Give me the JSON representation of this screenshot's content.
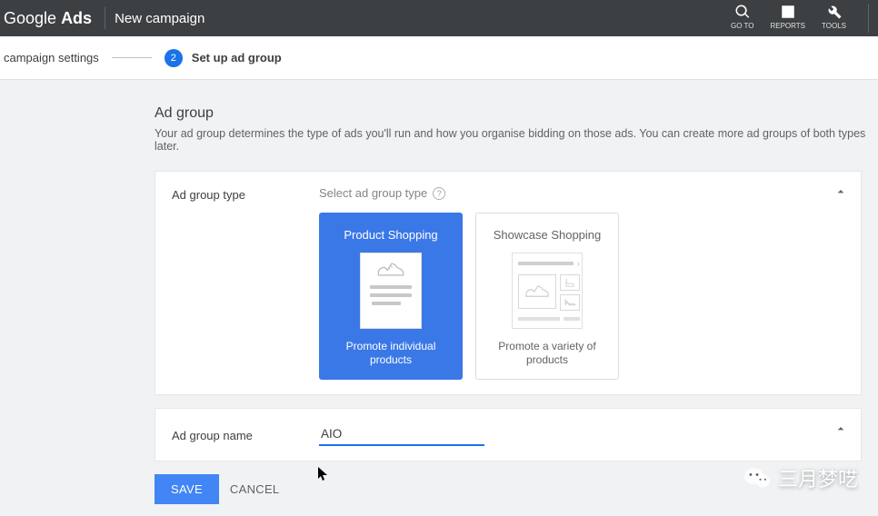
{
  "header": {
    "logo_a": "Google",
    "logo_b": "Ads",
    "title": "New campaign",
    "tools": [
      {
        "label": "GO TO",
        "icon": "search"
      },
      {
        "label": "REPORTS",
        "icon": "bar"
      },
      {
        "label": "TOOLS",
        "icon": "wrench"
      }
    ]
  },
  "steps": {
    "prev": "campaign settings",
    "active_num": "2",
    "active_label": "Set up ad group"
  },
  "section": {
    "title": "Ad group",
    "subtitle": "Your ad group determines the type of ads you'll run and how you organise bidding on those ads. You can create more ad groups of both types later."
  },
  "ad_group_type": {
    "label": "Ad group type",
    "hint": "Select ad group type",
    "options": [
      {
        "title": "Product Shopping",
        "desc": "Promote individual products",
        "selected": true
      },
      {
        "title": "Showcase Shopping",
        "desc": "Promote a variety of products",
        "selected": false
      }
    ]
  },
  "ad_group_name": {
    "label": "Ad group name",
    "value": "AIO"
  },
  "buttons": {
    "save": "SAVE",
    "cancel": "CANCEL"
  },
  "watermark": "三月梦呓"
}
